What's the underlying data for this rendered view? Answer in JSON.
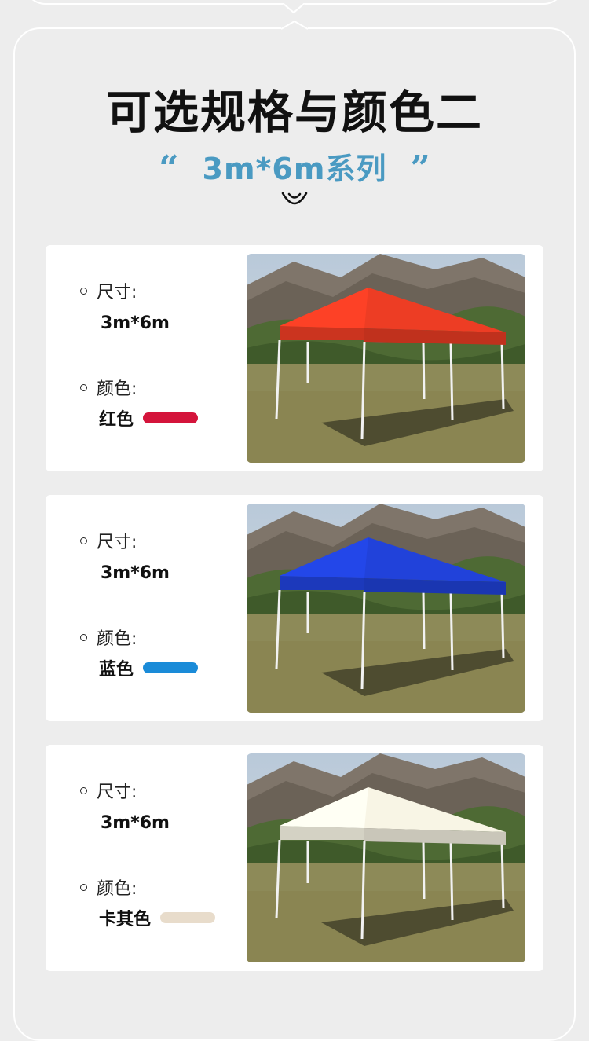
{
  "header": {
    "title": "可选规格与颜色二",
    "quote_open": "“",
    "subtitle": "3m*6m系列",
    "quote_close": "”",
    "accent_color": "#4a9ac2",
    "smile_icon": "smile-icon"
  },
  "products": [
    {
      "size_label": "尺寸:",
      "size_value": "3m*6m",
      "color_label": "颜色:",
      "color_name": "红色",
      "swatch_color": "#d4143b",
      "canopy_color": "#e23a22"
    },
    {
      "size_label": "尺寸:",
      "size_value": "3m*6m",
      "color_label": "颜色:",
      "color_name": "蓝色",
      "swatch_color": "#1a8bd8",
      "canopy_color": "#1f3fd0"
    },
    {
      "size_label": "尺寸:",
      "size_value": "3m*6m",
      "color_label": "颜色:",
      "color_name": "卡其色",
      "swatch_color": "#e8dccb",
      "canopy_color": "#ece9da"
    }
  ]
}
